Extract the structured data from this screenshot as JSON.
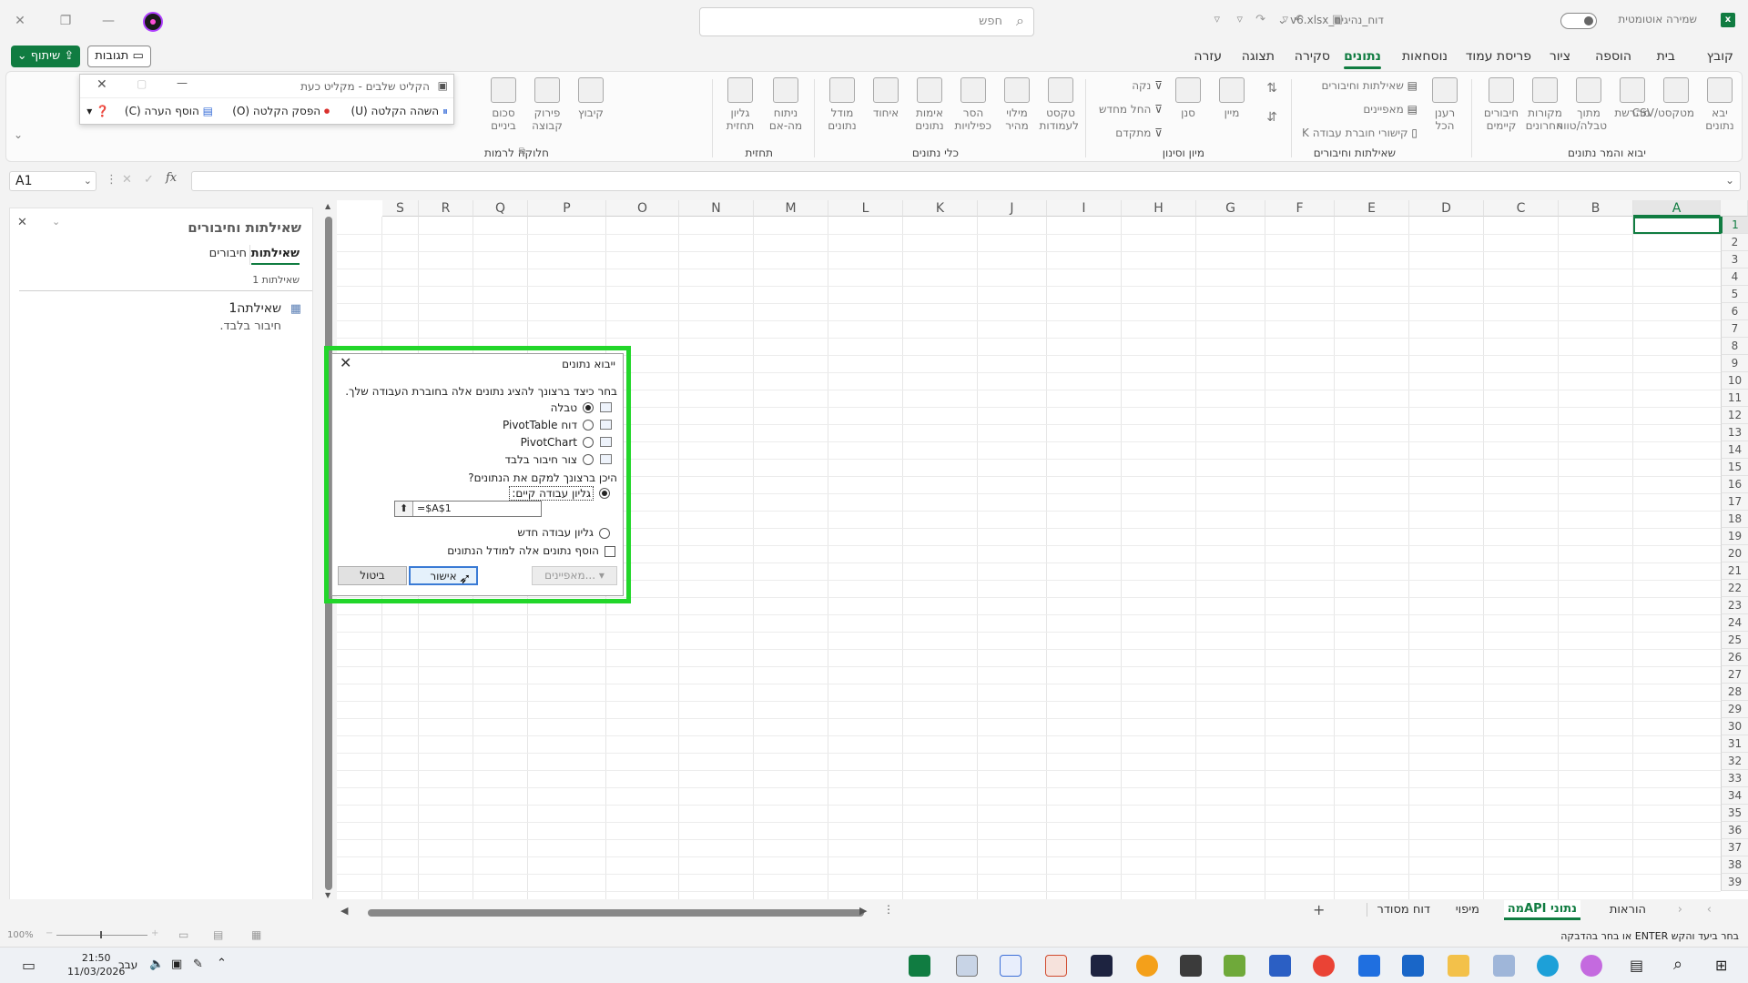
{
  "window": {
    "search_placeholder": "חפש",
    "doc_title": "דוח_נהיגים_v6.xlsx",
    "autosave_label": "שמירה אוטומטית"
  },
  "ribbon_tabs": [
    "קובץ",
    "בית",
    "הוספה",
    "ציור",
    "פריסת עמוד",
    "נוסחאות",
    "נתונים",
    "סקירה",
    "תצוגה",
    "עזרה"
  ],
  "active_tab": "נתונים",
  "share_label": "שיתוף",
  "comments_label": "תגובות",
  "ribbon": {
    "group_get_data": {
      "label": "יבוא והמר נתונים",
      "buttons": [
        "יבא נתונים",
        "מטקסט/CSV",
        "מהרשת",
        "מתוך טבלה/טווח",
        "מקורות אחרונים",
        "חיבורים קיימים"
      ]
    },
    "group_queries": {
      "label": "שאילתות וחיבורים",
      "refresh_all": "רענן הכל",
      "items": [
        "שאילתות וחיבורים",
        "מאפיינים",
        "קישורי חוברת עבודה"
      ]
    },
    "group_sort_filter": {
      "label": "מיון וסינון",
      "sort": "מיין",
      "filter": "סנן",
      "small": [
        "נקה",
        "החל מחדש",
        "מתקדם"
      ]
    },
    "group_data_tools": {
      "label": "כלי נתונים",
      "buttons": [
        "טקסט לעמודות",
        "מילוי מהיר",
        "הסר כפילויות",
        "אימות נתונים",
        "איחוד",
        "מודל נתונים"
      ]
    },
    "group_forecast": {
      "label": "תחזית",
      "buttons": [
        "ניתוח מה-אם",
        "גליון תחזית"
      ]
    },
    "group_outline": {
      "label": "חלוקה לרמות",
      "buttons": [
        "קיבוץ",
        "פירוק קבוצה",
        "סכום ביניים"
      ]
    }
  },
  "recording_toolbar": {
    "title": "הקליט שלבים - מקליט כעת",
    "pause": "השהה הקלטה",
    "pause_key": "(U)",
    "stop": "הפסק הקלטה",
    "stop_key": "(O)",
    "add_comment": "הוסף הערה",
    "add_comment_key": "(C)"
  },
  "formula_bar": {
    "name_box": "A1",
    "fx": "fx"
  },
  "queries_pane": {
    "title": "שאילתות וחיבורים",
    "tabs": [
      "שאילתות",
      "חיבורים"
    ],
    "count": "שאילתות 1",
    "query_name": "שאילתה1",
    "query_status": "חיבור בלבד."
  },
  "grid": {
    "columns": [
      "A",
      "B",
      "C",
      "D",
      "E",
      "F",
      "G",
      "H",
      "I",
      "J",
      "K",
      "L",
      "M",
      "N",
      "O",
      "P",
      "Q",
      "R",
      "S"
    ],
    "rows": [
      "1",
      "2",
      "3",
      "4",
      "5",
      "6",
      "7",
      "8",
      "9",
      "10",
      "11",
      "12",
      "13",
      "14",
      "15",
      "16",
      "17",
      "18",
      "19",
      "20",
      "21",
      "22",
      "23",
      "24",
      "25",
      "26",
      "27",
      "28",
      "29",
      "30",
      "31",
      "32",
      "33",
      "34",
      "35",
      "36",
      "37",
      "38",
      "39"
    ]
  },
  "dialog": {
    "title": "ייבוא נתונים",
    "question1": "בחר כיצד ברצונך להציג נתונים אלה בחוברת העבודה שלך.",
    "options": [
      "טבלה",
      "דוח PivotTable",
      "PivotChart",
      "צור חיבור בלבד"
    ],
    "question2": "היכן ברצונך למקם את הנתונים?",
    "existing_sheet": "גליון עבודה קיים:",
    "cell_ref": "=$A$1",
    "new_sheet": "גליון עבודה חדש",
    "add_to_model": "הוסף נתונים אלה למודל הנתונים",
    "properties_btn": "מאפיינים...",
    "ok_btn": "אישור",
    "cancel_btn": "ביטול"
  },
  "sheet_tabs": [
    "הוראות",
    "נתוני APIמה",
    "מיפוי",
    "דוח מסודר"
  ],
  "active_sheet": "נתוני APIמה",
  "status": {
    "hint": "בחר ביעד והקש ENTER או בחר בהדבקה",
    "zoom": "100%"
  },
  "taskbar": {
    "time": "21:50",
    "date": "11/03/2026",
    "lang": "עבר"
  },
  "colors": {
    "accent": "#107c41",
    "dialog_outline": "#22d62a",
    "record_dot": "#b040ff"
  }
}
